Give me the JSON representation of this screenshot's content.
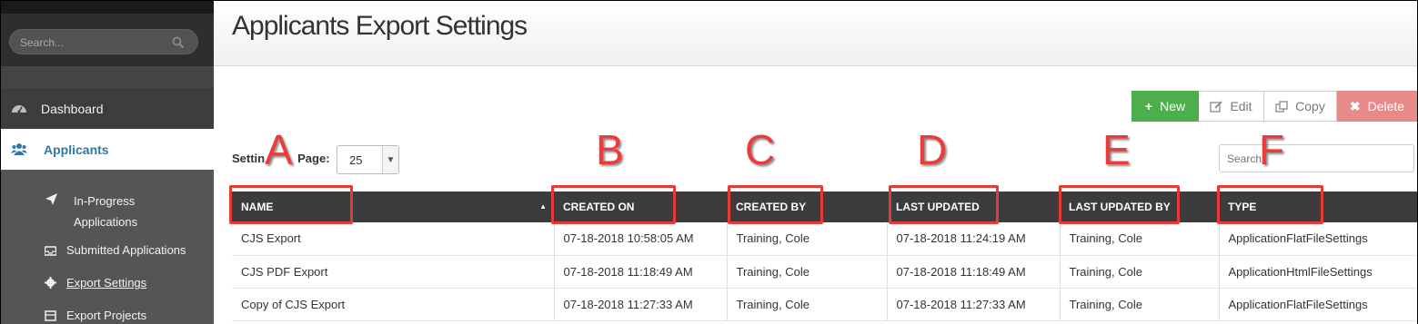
{
  "sidebar": {
    "search_placeholder": "Search...",
    "nav": {
      "dashboard": "Dashboard",
      "applicants": "Applicants"
    },
    "submenu": {
      "in_progress_line1": "In-Progress",
      "in_progress_line2": "Applications",
      "submitted": "Submitted Applications",
      "export_settings": "Export Settings",
      "export_projects": "Export Projects"
    }
  },
  "header": {
    "title": "Applicants Export Settings"
  },
  "toolbar": {
    "new_label": "New",
    "edit_label": "Edit",
    "copy_label": "Copy",
    "delete_label": "Delete"
  },
  "perpage": {
    "label_start": "Settin",
    "label_end": "Page:",
    "value": "25"
  },
  "table_search": {
    "placeholder": "Search"
  },
  "table": {
    "columns": [
      "NAME",
      "CREATED ON",
      "CREATED BY",
      "LAST UPDATED",
      "LAST UPDATED BY",
      "TYPE"
    ],
    "rows": [
      [
        "CJS Export",
        "07-18-2018 10:58:05 AM",
        "Training, Cole",
        "07-18-2018 11:24:19 AM",
        "Training, Cole",
        "ApplicationFlatFileSettings"
      ],
      [
        "CJS PDF Export",
        "07-18-2018 11:18:49 AM",
        "Training, Cole",
        "07-18-2018 11:18:49 AM",
        "Training, Cole",
        "ApplicationHtmlFileSettings"
      ],
      [
        "Copy of CJS Export",
        "07-18-2018 11:27:33 AM",
        "Training, Cole",
        "07-18-2018 11:27:33 AM",
        "Training, Cole",
        "ApplicationFlatFileSettings"
      ]
    ]
  },
  "annotations": {
    "letters": [
      "A",
      "B",
      "C",
      "D",
      "E",
      "F"
    ]
  },
  "colors": {
    "new_button": "#4cae4c",
    "delete_button": "#e68a8a",
    "annotation_red": "#e53a3a",
    "applicants_active": "#2a78a8"
  }
}
